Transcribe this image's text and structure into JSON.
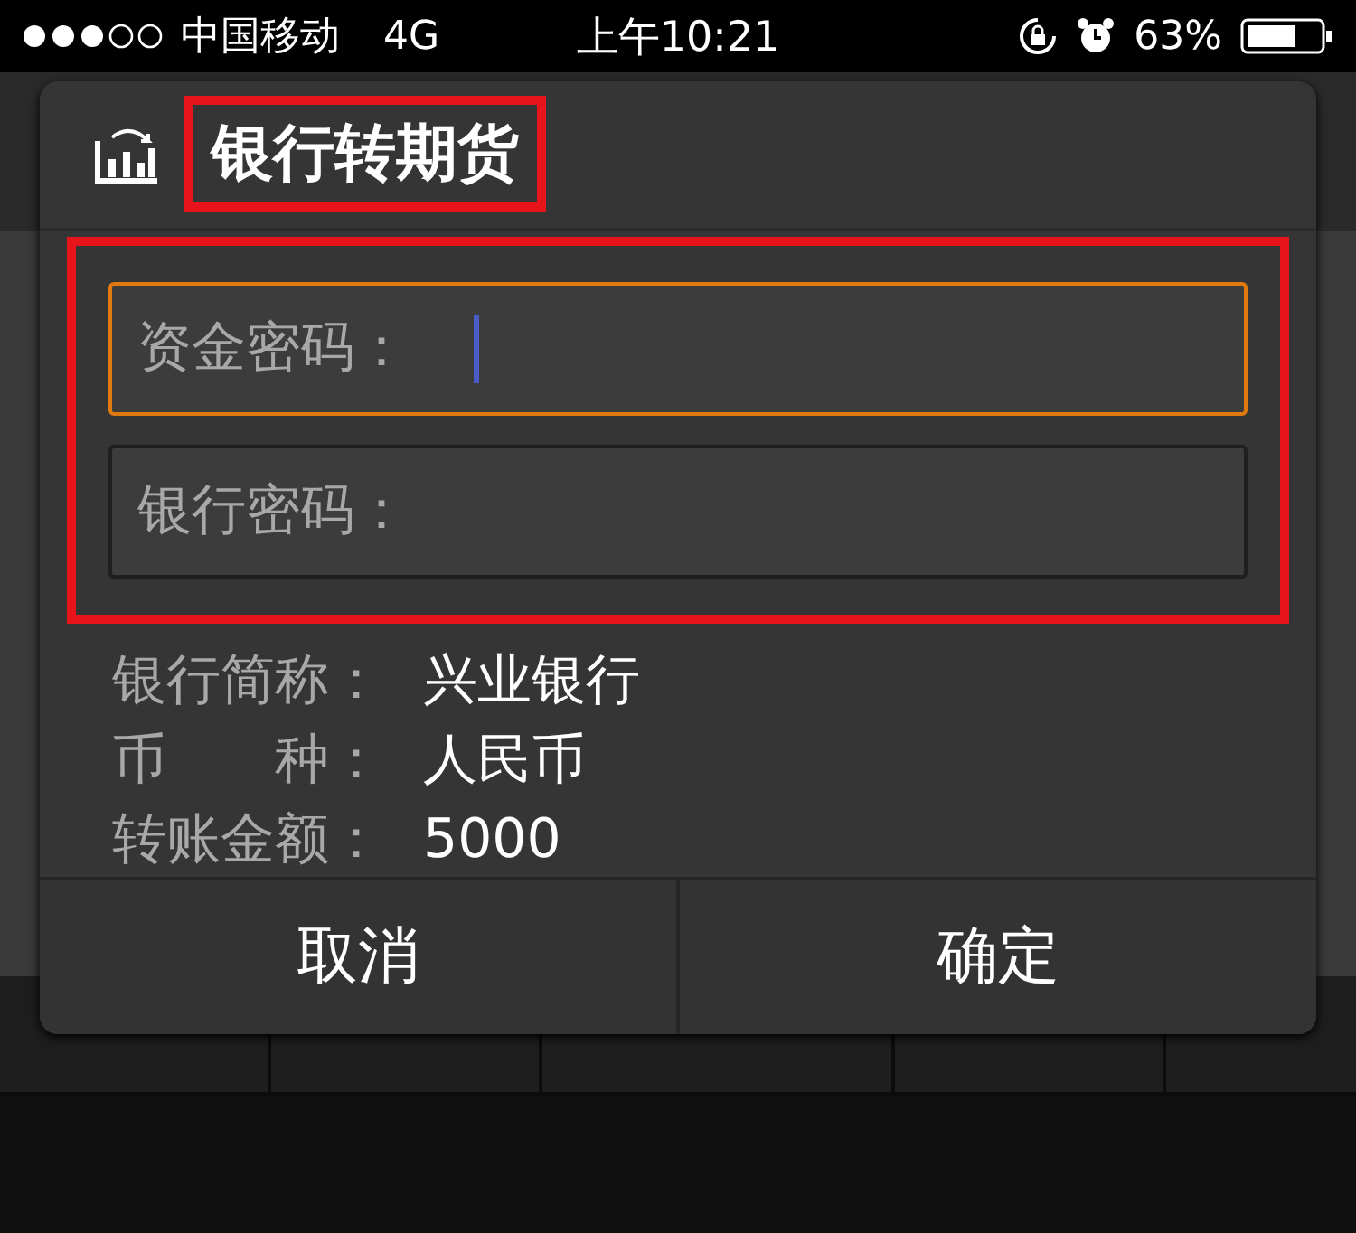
{
  "status_bar": {
    "carrier": "中国移动",
    "network": "4G",
    "time": "上午10:21",
    "battery": "63%"
  },
  "dialog": {
    "title": "银行转期货",
    "title_highlighted": true,
    "fields_highlighted": true,
    "fields": [
      {
        "label": "资金密码：",
        "focused": true
      },
      {
        "label": "银行密码：",
        "focused": false
      }
    ],
    "info": [
      {
        "label": "银行简称：",
        "value": "兴业银行"
      },
      {
        "label": "币　　种：",
        "value": "人民币"
      },
      {
        "label": "转账金额：",
        "value": "5000"
      }
    ],
    "buttons": [
      "取消",
      "确定"
    ]
  }
}
